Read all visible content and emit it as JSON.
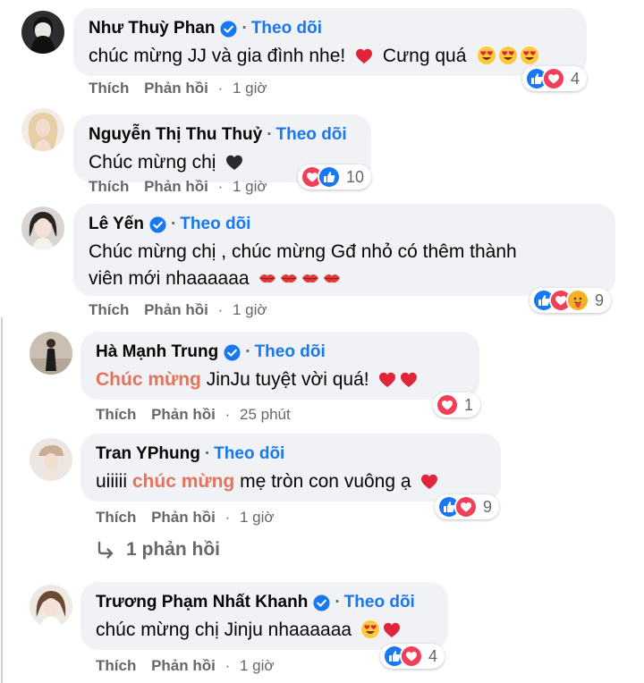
{
  "comments": [
    {
      "author": "Như Thuỳ Phan",
      "follow": "Theo dõi",
      "text": "chúc mừng JJ và gia đình nhe!",
      "text2": "Cưng quá",
      "like": "Thích",
      "reply": "Phản hồi",
      "time": "1 giờ",
      "reaction_count": "4"
    },
    {
      "author": "Nguyễn Thị Thu Thuỷ",
      "follow": "Theo dõi",
      "text": "Chúc mừng chị",
      "like": "Thích",
      "reply": "Phản hồi",
      "time": "1 giờ",
      "reaction_count": "10"
    },
    {
      "author": "Lê Yến",
      "follow": "Theo dõi",
      "text": "Chúc mừng chị , chúc mừng Gđ nhỏ có thêm thành",
      "text2": "viên mới nhaaaaaa",
      "like": "Thích",
      "reply": "Phản hồi",
      "time": "1 giờ",
      "reaction_count": "9"
    },
    {
      "author": "Hà Mạnh Trung",
      "follow": "Theo dõi",
      "highlight": "Chúc mừng",
      "text": "JinJu tuyệt vời quá!",
      "like": "Thích",
      "reply": "Phản hồi",
      "time": "25 phút",
      "reaction_count": "1"
    },
    {
      "author": "Tran YPhung",
      "follow": "Theo dõi",
      "text_pre": "uiiiii",
      "highlight": "chúc mừng",
      "text": "mẹ tròn con vuông ạ",
      "like": "Thích",
      "reply": "Phản hồi",
      "time": "1 giờ",
      "reaction_count": "9"
    },
    {
      "author": "Trương Phạm Nhất Khanh",
      "follow": "Theo dõi",
      "text": "chúc mừng chị Jinju nhaaaaaa",
      "like": "Thích",
      "reply": "Phản hồi",
      "time": "1 giờ",
      "reaction_count": "4"
    }
  ],
  "view_replies": "1 phản hồi",
  "icons": {
    "verified": "verified-badge-icon",
    "like": "like-reaction-icon",
    "love": "love-reaction-icon",
    "care": "care-reaction-icon",
    "heart": "red-heart-emoji",
    "black_heart": "black-heart-emoji",
    "heart_eyes": "heart-eyes-emoji",
    "kiss": "kiss-lips-emoji",
    "reply_arrow": "reply-arrow-icon"
  },
  "colors": {
    "bubble": "#f0f2f5",
    "link_blue": "#1877f2",
    "muted": "#65676b",
    "highlight": "#e5735b",
    "like_blue": "#1877f2",
    "love_red": "#f33e58"
  }
}
